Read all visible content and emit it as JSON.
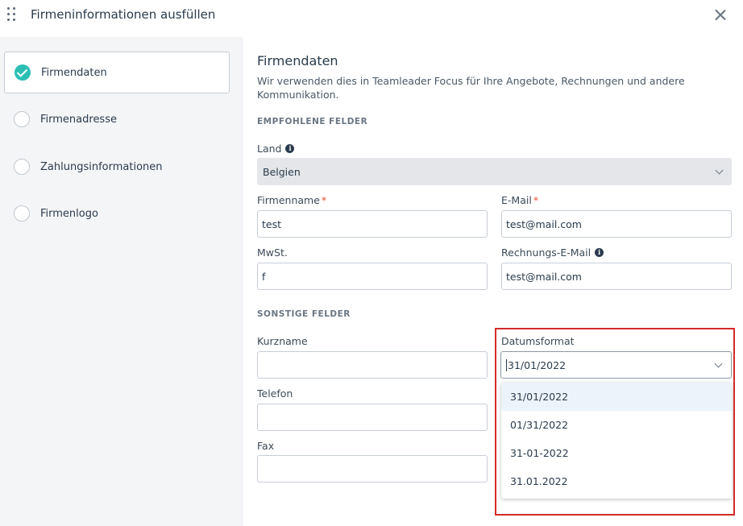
{
  "header": {
    "title": "Firmeninformationen ausfüllen"
  },
  "sidebar": {
    "items": [
      {
        "label": "Firmendaten",
        "state": "completed"
      },
      {
        "label": "Firmenadresse",
        "state": "pending"
      },
      {
        "label": "Zahlungsinformationen",
        "state": "pending"
      },
      {
        "label": "Firmenlogo",
        "state": "pending"
      }
    ]
  },
  "main": {
    "title": "Firmendaten",
    "description": "Wir verwenden dies in Teamleader Focus für Ihre Angebote, Rechnungen und andere Kommunikation.",
    "recommended_heading": "EMPFOHLENE FELDER",
    "other_heading": "SONSTIGE FELDER",
    "required_marker": "*",
    "fields": {
      "country": {
        "label": "Land",
        "value": "Belgien"
      },
      "company_name": {
        "label": "Firmenname",
        "value": "test"
      },
      "email": {
        "label": "E-Mail",
        "value": "test@mail.com"
      },
      "vat": {
        "label": "MwSt.",
        "value": "f"
      },
      "invoice_email": {
        "label": "Rechnungs-E-Mail",
        "value": "test@mail.com"
      },
      "short_name": {
        "label": "Kurzname",
        "value": ""
      },
      "phone": {
        "label": "Telefon",
        "value": ""
      },
      "fax": {
        "label": "Fax",
        "value": ""
      },
      "date_format": {
        "label": "Datumsformat",
        "value": "31/01/2022",
        "options": [
          "31/01/2022",
          "01/31/2022",
          "31-01-2022",
          "31.01.2022"
        ],
        "highlighted_option": 0
      }
    }
  },
  "colors": {
    "accent": "#2bbfb4",
    "highlight_border": "#d42a2a",
    "required": "#e0503a"
  }
}
